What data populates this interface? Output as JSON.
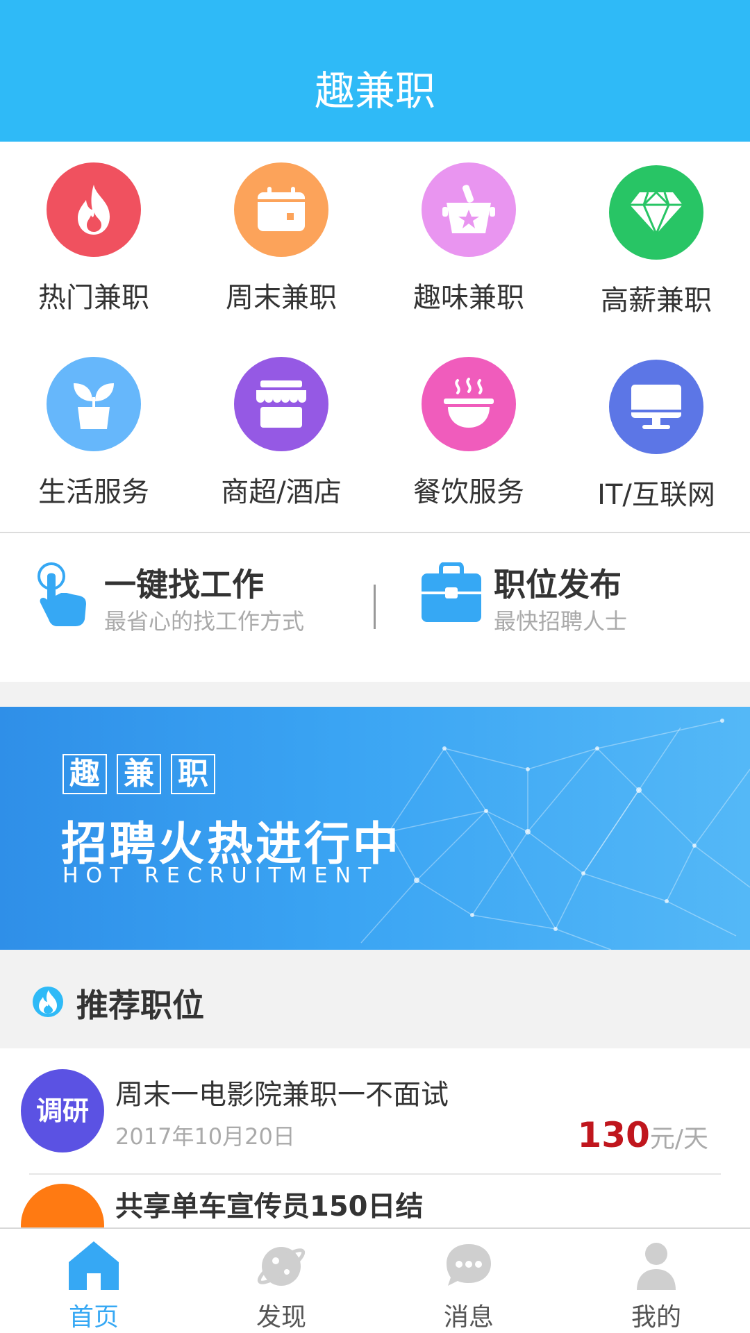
{
  "header": {
    "title": "趣兼职"
  },
  "categories": [
    {
      "label": "热门兼职",
      "icon": "flame-icon",
      "color": "#f0515f"
    },
    {
      "label": "周末兼职",
      "icon": "calendar-icon",
      "color": "#fca35a"
    },
    {
      "label": "趣味兼职",
      "icon": "ice-bucket-icon",
      "color": "#e995f0"
    },
    {
      "label": "高薪兼职",
      "icon": "diamond-icon",
      "color": "#28c565"
    },
    {
      "label": "生活服务",
      "icon": "plant-pot-icon",
      "color": "#66b7fb"
    },
    {
      "label": "商超/酒店",
      "icon": "store-icon",
      "color": "#9559e4"
    },
    {
      "label": "餐饮服务",
      "icon": "hot-bowl-icon",
      "color": "#f05cbc"
    },
    {
      "label": "IT/互联网",
      "icon": "monitor-icon",
      "color": "#5c76e6"
    }
  ],
  "quick_actions": {
    "find_job": {
      "title": "一键找工作",
      "subtitle": "最省心的找工作方式",
      "icon": "tap-hand-icon"
    },
    "post_job": {
      "title": "职位发布",
      "subtitle": "最快招聘人士",
      "icon": "briefcase-icon"
    }
  },
  "banner": {
    "logo_chars": [
      "趣",
      "兼",
      "职"
    ],
    "title": "招聘火热进行中",
    "subtitle": "HOT RECRUITMENT"
  },
  "section": {
    "title": "推荐职位",
    "icon": "flame-icon"
  },
  "jobs": [
    {
      "avatar_text": "调研",
      "avatar_color": "#5b52e3",
      "title": "周末一电影院兼职一不面试",
      "date": "2017年10月20日",
      "pay": "130",
      "unit": "元/天"
    },
    {
      "avatar_text": "",
      "avatar_color": "#ff7a12",
      "title": "共享单车宣传员150日结",
      "date": "",
      "pay": "",
      "unit": ""
    }
  ],
  "tabs": [
    {
      "label": "首页",
      "icon": "home-icon",
      "active": true
    },
    {
      "label": "发现",
      "icon": "discover-icon",
      "active": false
    },
    {
      "label": "消息",
      "icon": "message-icon",
      "active": false
    },
    {
      "label": "我的",
      "icon": "user-icon",
      "active": false
    }
  ],
  "colors": {
    "primary": "#2fbaf7",
    "price": "#c0161d",
    "tab_active": "#36a8f4",
    "tab_inactive": "#555555"
  }
}
